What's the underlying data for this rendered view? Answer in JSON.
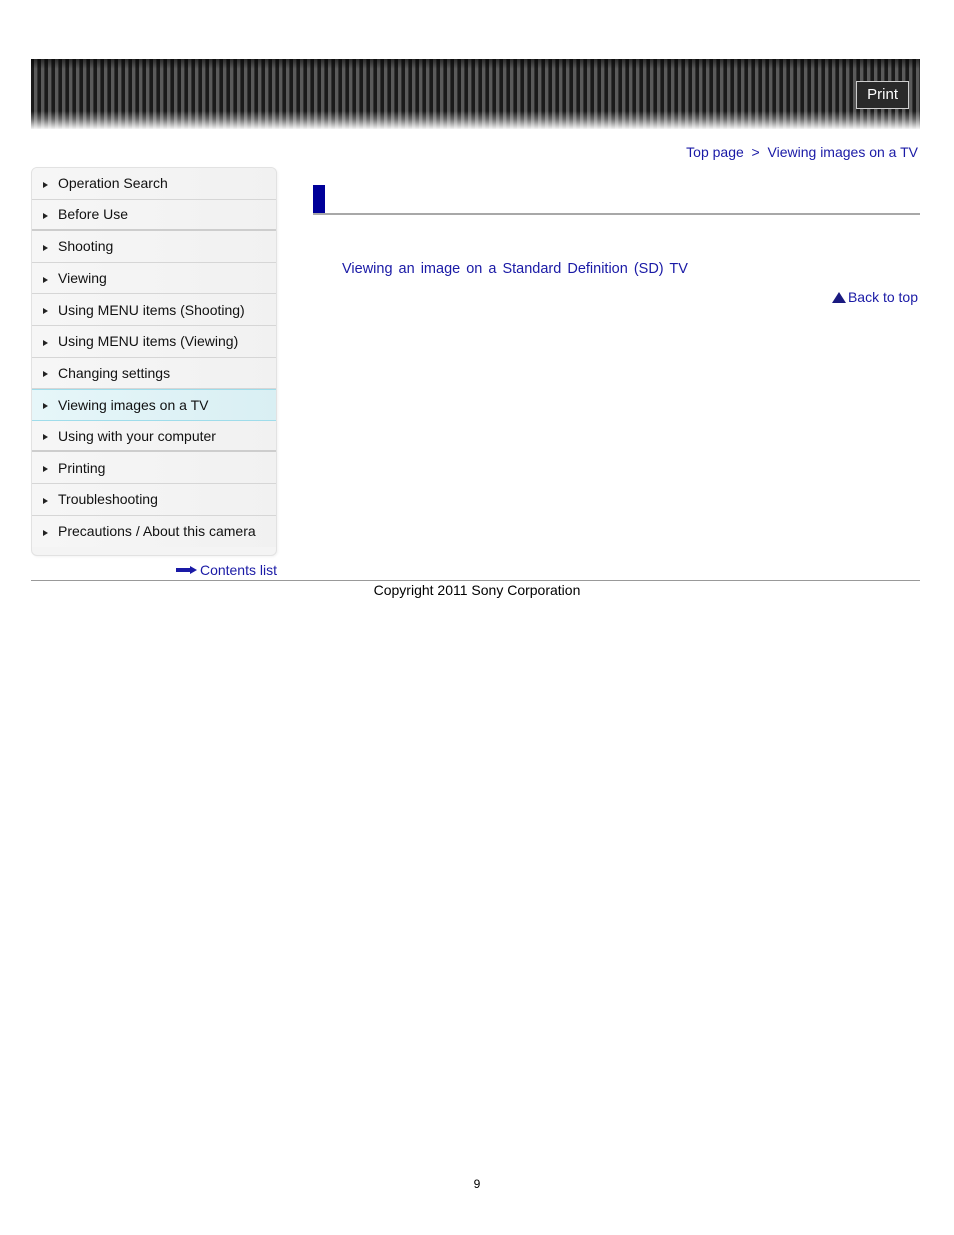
{
  "header": {
    "print_label": "Print"
  },
  "breadcrumb": {
    "items": [
      "Top page",
      "Viewing images on a TV"
    ],
    "separator": ">"
  },
  "sidebar": {
    "items": [
      {
        "label": "Operation Search"
      },
      {
        "label": "Before Use"
      },
      {
        "label": "Shooting"
      },
      {
        "label": "Viewing"
      },
      {
        "label": "Using MENU items (Shooting)"
      },
      {
        "label": "Using MENU items (Viewing)"
      },
      {
        "label": "Changing settings"
      },
      {
        "label": "Viewing images on a TV",
        "active": true
      },
      {
        "label": "Using with your computer"
      },
      {
        "label": "Printing"
      },
      {
        "label": "Troubleshooting"
      },
      {
        "label": "Precautions / About this camera"
      }
    ],
    "contents_list": "Contents list"
  },
  "main": {
    "title": "",
    "links": [
      "Viewing an image on a Standard Definition (SD) TV"
    ],
    "back_to_top": "Back to top"
  },
  "footer": {
    "copyright": "Copyright 2011 Sony Corporation",
    "page_number": "9"
  },
  "colors": {
    "link": "#1a1aa6",
    "accent": "#000099",
    "active_bg": "#dff3f7"
  }
}
